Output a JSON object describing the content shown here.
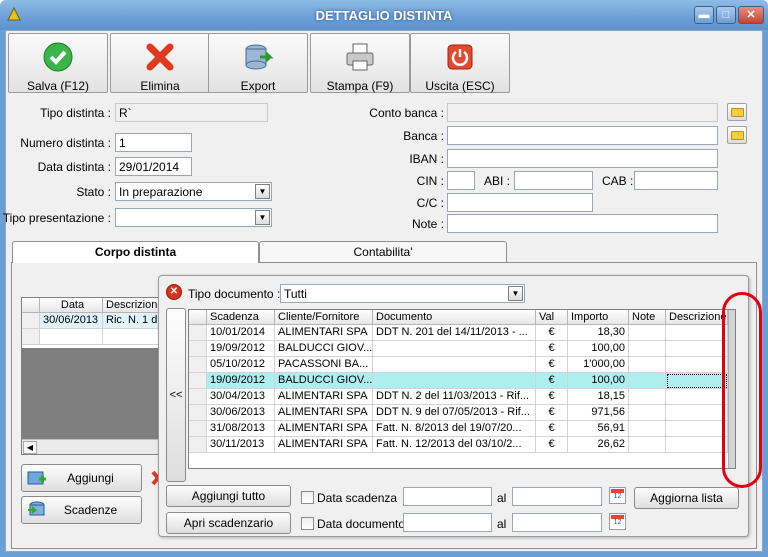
{
  "window": {
    "title": "DETTAGLIO DISTINTA",
    "controls": {
      "minimize": "▬",
      "maximize": "□",
      "close": "✕"
    }
  },
  "toolbar": {
    "save": "Salva (F12)",
    "delete": "Elimina",
    "export": "Export",
    "print": "Stampa (F9)",
    "exit": "Uscita (ESC)"
  },
  "form": {
    "tipo_distinta_label": "Tipo distinta :",
    "tipo_distinta_value": "R`",
    "numero_label": "Numero distinta :",
    "numero_value": "1",
    "data_label": "Data distinta :",
    "data_value": "29/01/2014",
    "stato_label": "Stato :",
    "stato_value": "In preparazione",
    "tipo_pres_label": "Tipo presentazione :",
    "tipo_pres_value": "",
    "conto_banca_label": "Conto banca :",
    "conto_banca_value": "",
    "banca_label": "Banca :",
    "banca_value": "",
    "iban_label": "IBAN :",
    "iban_value": "",
    "cin_label": "CIN :",
    "cin_value": "",
    "abi_label": "ABI :",
    "abi_value": "",
    "cab_label": "CAB :",
    "cab_value": "",
    "cc_label": "C/C :",
    "cc_value": "",
    "note_label": "Note :",
    "note_value": ""
  },
  "tabs": {
    "corpo": "Corpo distinta",
    "contabilita": "Contabilita'"
  },
  "body_grid": {
    "headers": [
      "Data",
      "Descrizion"
    ],
    "rows": [
      [
        "30/06/2013",
        "Ric. N. 1 d"
      ]
    ]
  },
  "body_buttons": {
    "aggiungi": "Aggiungi",
    "scadenze": "Scadenze"
  },
  "popup": {
    "tipo_doc_label": "Tipo documento :",
    "tipo_doc_value": "Tutti",
    "collapse": "<<",
    "headers": [
      "Scadenza",
      "Cliente/Fornitore",
      "Documento",
      "Val",
      "Importo",
      "Note",
      "Descrizione"
    ],
    "rows": [
      [
        "10/01/2014",
        "ALIMENTARI SPA",
        "DDT N. 201 del 14/11/2013 - ...",
        "€",
        "18,30",
        "",
        ""
      ],
      [
        "19/09/2012",
        "BALDUCCI GIOV...",
        "",
        "€",
        "100,00",
        "",
        ""
      ],
      [
        "05/10/2012",
        "PACASSONI BA...",
        "",
        "€",
        "1'000,00",
        "",
        ""
      ],
      [
        "19/09/2012",
        "BALDUCCI GIOV...",
        "",
        "€",
        "100,00",
        "",
        ""
      ],
      [
        "30/04/2013",
        "ALIMENTARI SPA",
        "DDT N. 2 del 11/03/2013 - Rif...",
        "€",
        "18,15",
        "",
        ""
      ],
      [
        "30/06/2013",
        "ALIMENTARI SPA",
        "DDT N. 9 del 07/05/2013 - Rif...",
        "€",
        "971,56",
        "",
        ""
      ],
      [
        "31/08/2013",
        "ALIMENTARI SPA",
        "Fatt. N. 8/2013 del 19/07/20...",
        "€",
        "56,91",
        "",
        ""
      ],
      [
        "30/11/2013",
        "ALIMENTARI SPA",
        "Fatt. N. 12/2013 del 03/10/2...",
        "€",
        "26,62",
        "",
        ""
      ]
    ],
    "aggiungi_tutto": "Aggiungi tutto",
    "apri_scadenzario": "Apri scadenzario",
    "data_scadenza": "Data scadenza",
    "data_documento": "Data documento",
    "al": "al",
    "aggiorna": "Aggiorna lista"
  },
  "colors": {
    "title_bar": "#6b9fd6",
    "selected_row": "#aeeef0",
    "highlight": "#e3000f"
  }
}
